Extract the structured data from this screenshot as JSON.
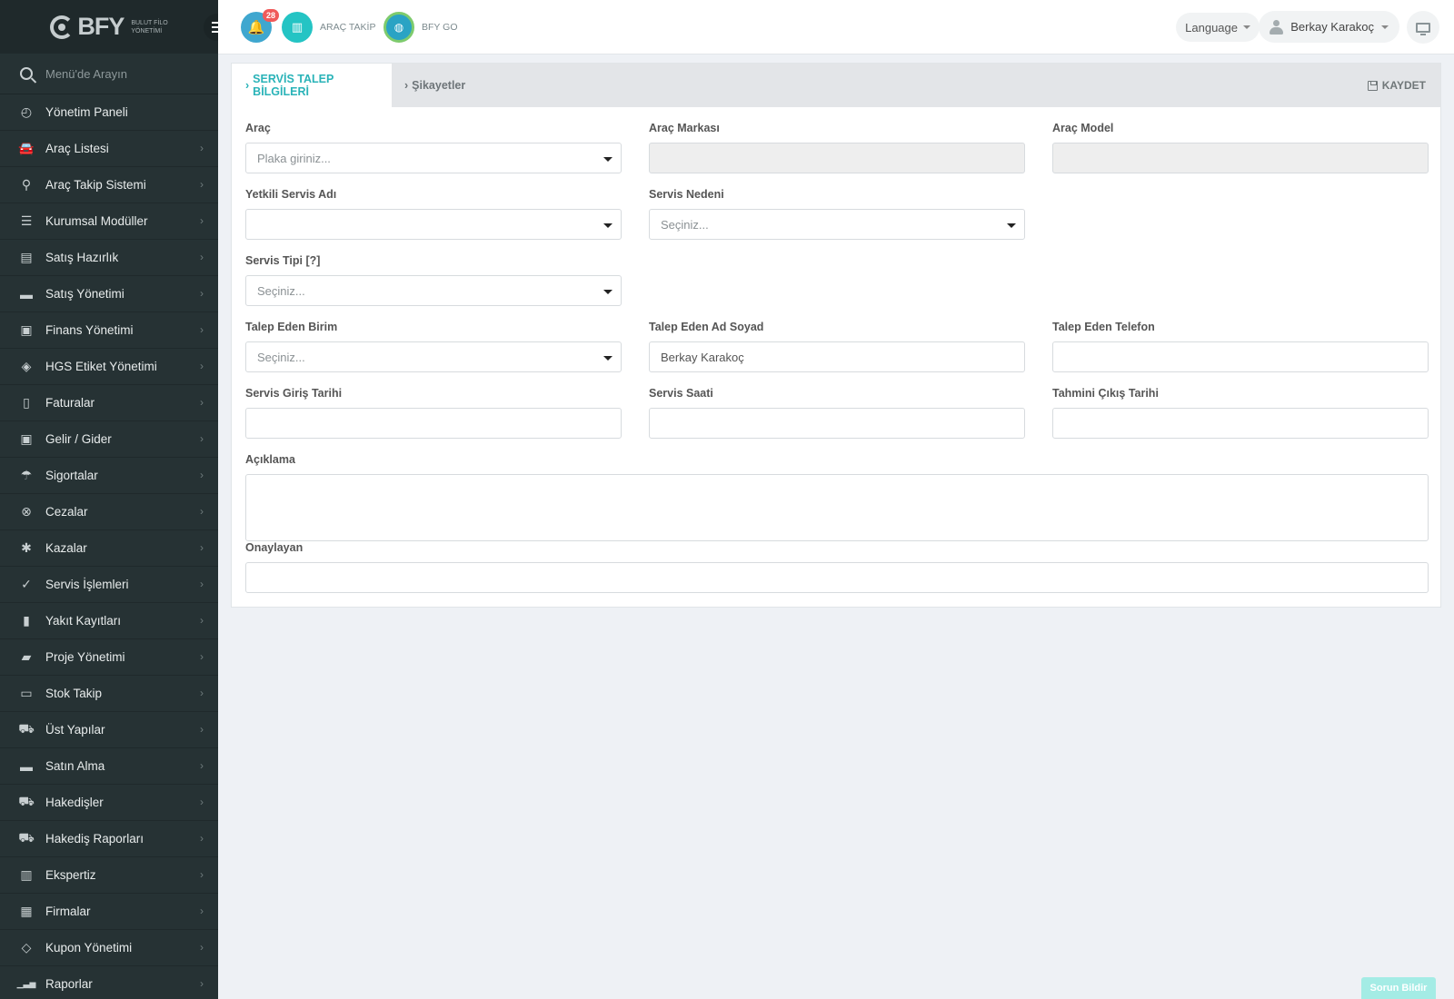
{
  "app": {
    "logo_text": "BFY",
    "logo_sub_line1": "BULUT FİLO",
    "logo_sub_line2": "YÖNETİMİ"
  },
  "sidebar": {
    "search_placeholder": "Menü'de Arayın",
    "items": [
      {
        "label": "Yönetim Paneli",
        "icon": "dashboard-icon"
      },
      {
        "label": "Araç Listesi",
        "icon": "car-icon"
      },
      {
        "label": "Araç Takip Sistemi",
        "icon": "map-pin-icon"
      },
      {
        "label": "Kurumsal Modüller",
        "icon": "server-icon"
      },
      {
        "label": "Satış Hazırlık",
        "icon": "book-icon"
      },
      {
        "label": "Satış Yönetimi",
        "icon": "card-icon"
      },
      {
        "label": "Finans Yönetimi",
        "icon": "money-icon"
      },
      {
        "label": "HGS Etiket Yönetimi",
        "icon": "tag-icon"
      },
      {
        "label": "Faturalar",
        "icon": "file-icon"
      },
      {
        "label": "Gelir / Gider",
        "icon": "cash-icon"
      },
      {
        "label": "Sigortalar",
        "icon": "umbrella-icon"
      },
      {
        "label": "Cezalar",
        "icon": "x-circle-icon"
      },
      {
        "label": "Kazalar",
        "icon": "crash-icon"
      },
      {
        "label": "Servis İşlemleri",
        "icon": "check-circle-icon"
      },
      {
        "label": "Yakıt Kayıtları",
        "icon": "fuel-icon"
      },
      {
        "label": "Proje Yönetimi",
        "icon": "briefcase-icon"
      },
      {
        "label": "Stok Takip",
        "icon": "inbox-icon"
      },
      {
        "label": "Üst Yapılar",
        "icon": "truck-icon"
      },
      {
        "label": "Satın Alma",
        "icon": "credit-card-icon"
      },
      {
        "label": "Hakedişler",
        "icon": "truck-icon"
      },
      {
        "label": "Hakediş Raporları",
        "icon": "truck-icon"
      },
      {
        "label": "Ekspertiz",
        "icon": "report-icon"
      },
      {
        "label": "Firmalar",
        "icon": "building-icon"
      },
      {
        "label": "Kupon Yönetimi",
        "icon": "ticket-icon"
      },
      {
        "label": "Raporlar",
        "icon": "bar-chart-icon"
      }
    ]
  },
  "topbar": {
    "notification_count": "28",
    "arac_takip_label": "ARAÇ TAKİP",
    "bfy_go_label": "BFY GO",
    "language_label": "Language",
    "user_name": "Berkay Karakoç"
  },
  "tabs": {
    "active": "SERVİS TALEP BİLGİLERİ",
    "inactive": "Şikayetler",
    "save_label": "KAYDET"
  },
  "form": {
    "arac": {
      "label": "Araç",
      "placeholder": "Plaka giriniz..."
    },
    "arac_markasi": {
      "label": "Araç Markası",
      "value": ""
    },
    "arac_model": {
      "label": "Araç Model",
      "value": ""
    },
    "yetkili_servis": {
      "label": "Yetkili Servis Adı",
      "value": ""
    },
    "servis_nedeni": {
      "label": "Servis Nedeni",
      "placeholder": "Seçiniz..."
    },
    "servis_tipi": {
      "label": "Servis Tipi [?]",
      "placeholder": "Seçiniz..."
    },
    "talep_eden_birim": {
      "label": "Talep Eden Birim",
      "placeholder": "Seçiniz..."
    },
    "talep_eden_ad": {
      "label": "Talep Eden Ad Soyad",
      "value": "Berkay Karakoç"
    },
    "talep_eden_tel": {
      "label": "Talep Eden Telefon",
      "value": ""
    },
    "servis_giris": {
      "label": "Servis Giriş Tarihi",
      "value": ""
    },
    "servis_saati": {
      "label": "Servis Saati",
      "value": ""
    },
    "tahmini_cikis": {
      "label": "Tahmini Çıkış Tarihi",
      "value": ""
    },
    "aciklama": {
      "label": "Açıklama",
      "value": ""
    },
    "onaylayan": {
      "label": "Onaylayan",
      "value": ""
    }
  },
  "footer": {
    "report_issue_label": "Sorun Bildir"
  },
  "colors": {
    "sidebar_bg": "#263234",
    "accent_teal": "#2ab3b8",
    "badge_red": "#f05a5a"
  }
}
